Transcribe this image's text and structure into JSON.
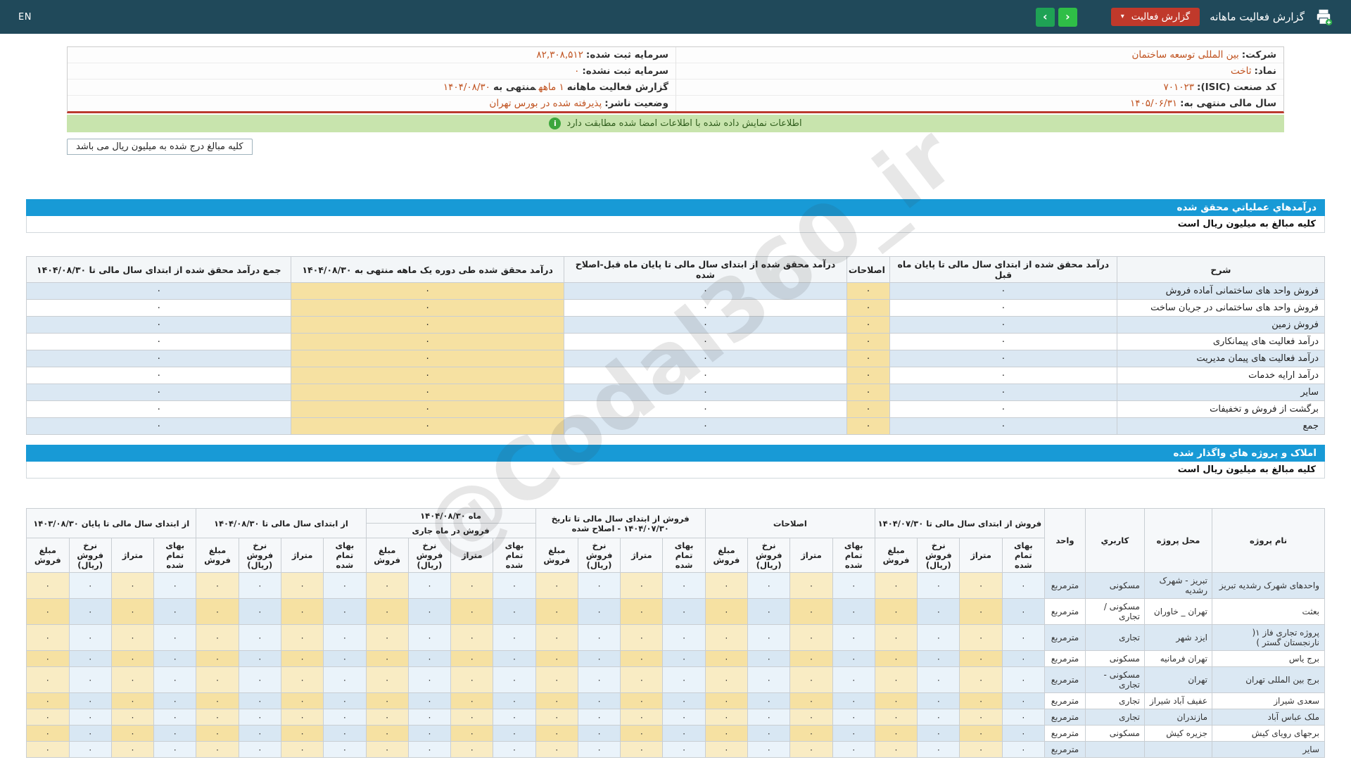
{
  "colors": {
    "navbar_bg": "#20495a",
    "accent_blue": "#189ad6",
    "button_red": "#c0392b",
    "notice_green_bg": "#c8e4ad",
    "highlight_tan": "#f6e1a2",
    "stripe_blue": "#dbe8f3",
    "value_orange": "#c0521f",
    "nav_green": "#2fbe47"
  },
  "navbar": {
    "en_label": "EN",
    "title": "گزارش فعالیت ماهانه",
    "report_button_label": "گزارش فعالیت",
    "caret_icon": "▾",
    "prev_icon": "‹",
    "next_icon": "›"
  },
  "company_info": {
    "right_rows": [
      {
        "label": "شرکت:",
        "value": "بین المللی توسعه ساختمان"
      },
      {
        "label": "نماد:",
        "value": "ثاخت"
      },
      {
        "label": "کد صنعت (ISIC):",
        "value": "۷۰۱۰۲۳"
      },
      {
        "label": "سال مالی منتهی به:",
        "value": "۱۴۰۵/۰۶/۳۱"
      }
    ],
    "left_rows": [
      {
        "label": "سرمایه ثبت شده:",
        "value": "۸۲,۳۰۸,۵۱۲",
        "label2": "",
        "value2": ""
      },
      {
        "label": "سرمایه ثبت نشده:",
        "value": "۰",
        "label2": "",
        "value2": ""
      },
      {
        "label": "گزارش فعالیت ماهانه",
        "value": "۱ ماهه",
        "label2": "منتهی به",
        "value2": "۱۴۰۴/۰۸/۳۰"
      },
      {
        "label": "وضعیت ناشر:",
        "value": "پذیرفته شده در بورس تهران",
        "label2": "",
        "value2": ""
      }
    ]
  },
  "notice": {
    "text": "اطلاعات نمایش داده شده با اطلاعات امضا شده مطابقت دارد",
    "icon": "i"
  },
  "amounts_tab": {
    "label": "کلیه مبالغ درج شده به میلیون ریال می باشد"
  },
  "section_revenue": {
    "title": "درآمدهاي عملياتي محقق شده",
    "subtitle": "کلیه مبالغ به میلیون ریال است",
    "table": {
      "headers": [
        "شرح",
        "درآمد محقق شده از ابتدای سال مالی تا پایان ماه قبل",
        "اصلاحات",
        "درآمد محقق شده از ابتدای سال مالی تا پایان ماه قبل-اصلاح شده",
        "درآمد محقق شده طی دوره یک ماهه منتهی به ۱۴۰۴/۰۸/۳۰",
        "جمع درآمد محقق شده از ابتدای سال مالی تا ۱۴۰۴/۰۸/۳۰"
      ],
      "rows": [
        {
          "label": "فروش واحد های ساختمانی آماده فروش",
          "values": [
            "۰",
            "۰",
            "۰",
            "۰",
            "۰"
          ]
        },
        {
          "label": "فروش واحد های ساختمانی در جریان ساخت",
          "values": [
            "۰",
            "۰",
            "۰",
            "۰",
            "۰"
          ]
        },
        {
          "label": "فروش زمین",
          "values": [
            "۰",
            "۰",
            "۰",
            "۰",
            "۰"
          ]
        },
        {
          "label": "درآمد فعالیت های پیمانکاری",
          "values": [
            "۰",
            "۰",
            "۰",
            "۰",
            "۰"
          ]
        },
        {
          "label": "درآمد فعالیت های پیمان مدیریت",
          "values": [
            "۰",
            "۰",
            "۰",
            "۰",
            "۰"
          ]
        },
        {
          "label": "درآمد ارایه خدمات",
          "values": [
            "۰",
            "۰",
            "۰",
            "۰",
            "۰"
          ]
        },
        {
          "label": "سایر",
          "values": [
            "۰",
            "۰",
            "۰",
            "۰",
            "۰"
          ]
        },
        {
          "label": "برگشت از فروش و تخفیفات",
          "values": [
            "۰",
            "۰",
            "۰",
            "۰",
            "۰"
          ]
        },
        {
          "label": "جمع",
          "values": [
            "۰",
            "۰",
            "۰",
            "۰",
            "۰"
          ]
        }
      ]
    }
  },
  "section_projects": {
    "title": "املاک و پروژه هاي واگذار شده",
    "subtitle": "کلیه مبالغ به میلیون ریال است",
    "table": {
      "fixed_headers": [
        "نام پروژه",
        "محل پروژه",
        "کاربري",
        "واحد"
      ],
      "col_groups": [
        {
          "label": "فروش از ابتدای سال مالی تا ۱۴۰۴/۰۷/۳۰"
        },
        {
          "label": "اصلاحات"
        },
        {
          "label": "فروش از ابتدای سال مالی تا تاریخ ۱۴۰۴/۰۷/۳۰ - اصلاح شده"
        },
        {
          "label": "ماه ۱۴۰۴/۰۸/۳۰",
          "sub": "فروش در ماه جاری"
        },
        {
          "label": "از ابتدای سال مالی تا ۱۴۰۴/۰۸/۳۰"
        },
        {
          "label": "از ابتدای سال مالی تا پایان ۱۴۰۳/۰۸/۳۰"
        }
      ],
      "sub_headers": [
        "بهای تمام شده",
        "متراژ",
        "نرخ فروش (ریال)",
        "مبلغ فروش"
      ],
      "rows": [
        {
          "name": "واحدهای شهرک رشدیه تبریز",
          "location": "تبریز - شهرک رشدیه",
          "usage": "مسکونی",
          "unit": "مترمربع",
          "values": [
            "۰",
            "۰",
            "۰",
            "۰",
            "۰",
            "۰",
            "۰",
            "۰",
            "۰",
            "۰",
            "۰",
            "۰",
            "۰",
            "۰",
            "۰",
            "۰",
            "۰",
            "۰",
            "۰",
            "۰",
            "۰",
            "۰",
            "۰",
            "۰"
          ]
        },
        {
          "name": "بعثت",
          "location": "تهران _ خاوران",
          "usage": "مسکونی / تجاری",
          "unit": "مترمربع",
          "values": [
            "۰",
            "۰",
            "۰",
            "۰",
            "۰",
            "۰",
            "۰",
            "۰",
            "۰",
            "۰",
            "۰",
            "۰",
            "۰",
            "۰",
            "۰",
            "۰",
            "۰",
            "۰",
            "۰",
            "۰",
            "۰",
            "۰",
            "۰",
            "۰"
          ]
        },
        {
          "name": "پروژه تجاری فاز ۱( نارنجستان گستر )",
          "location": "ایزد شهر",
          "usage": "تجاری",
          "unit": "مترمربع",
          "values": [
            "۰",
            "۰",
            "۰",
            "۰",
            "۰",
            "۰",
            "۰",
            "۰",
            "۰",
            "۰",
            "۰",
            "۰",
            "۰",
            "۰",
            "۰",
            "۰",
            "۰",
            "۰",
            "۰",
            "۰",
            "۰",
            "۰",
            "۰",
            "۰"
          ]
        },
        {
          "name": "برج یاس",
          "location": "تهران فرمانیه",
          "usage": "مسکونی",
          "unit": "مترمربع",
          "values": [
            "۰",
            "۰",
            "۰",
            "۰",
            "۰",
            "۰",
            "۰",
            "۰",
            "۰",
            "۰",
            "۰",
            "۰",
            "۰",
            "۰",
            "۰",
            "۰",
            "۰",
            "۰",
            "۰",
            "۰",
            "۰",
            "۰",
            "۰",
            "۰"
          ]
        },
        {
          "name": "برج بین المللی تهران",
          "location": "تهران",
          "usage": "مسکونی - تجاری",
          "unit": "مترمربع",
          "values": [
            "۰",
            "۰",
            "۰",
            "۰",
            "۰",
            "۰",
            "۰",
            "۰",
            "۰",
            "۰",
            "۰",
            "۰",
            "۰",
            "۰",
            "۰",
            "۰",
            "۰",
            "۰",
            "۰",
            "۰",
            "۰",
            "۰",
            "۰",
            "۰"
          ]
        },
        {
          "name": "سعدی شیراز",
          "location": "عفیف آباد شیراز",
          "usage": "تجاری",
          "unit": "مترمربع",
          "values": [
            "۰",
            "۰",
            "۰",
            "۰",
            "۰",
            "۰",
            "۰",
            "۰",
            "۰",
            "۰",
            "۰",
            "۰",
            "۰",
            "۰",
            "۰",
            "۰",
            "۰",
            "۰",
            "۰",
            "۰",
            "۰",
            "۰",
            "۰",
            "۰"
          ]
        },
        {
          "name": "ملک عباس آباد",
          "location": "مازندران",
          "usage": "تجاری",
          "unit": "مترمربع",
          "values": [
            "۰",
            "۰",
            "۰",
            "۰",
            "۰",
            "۰",
            "۰",
            "۰",
            "۰",
            "۰",
            "۰",
            "۰",
            "۰",
            "۰",
            "۰",
            "۰",
            "۰",
            "۰",
            "۰",
            "۰",
            "۰",
            "۰",
            "۰",
            "۰"
          ]
        },
        {
          "name": "برجهای رویای کیش",
          "location": "جزیره کیش",
          "usage": "مسکونی",
          "unit": "مترمربع",
          "values": [
            "۰",
            "۰",
            "۰",
            "۰",
            "۰",
            "۰",
            "۰",
            "۰",
            "۰",
            "۰",
            "۰",
            "۰",
            "۰",
            "۰",
            "۰",
            "۰",
            "۰",
            "۰",
            "۰",
            "۰",
            "۰",
            "۰",
            "۰",
            "۰"
          ]
        },
        {
          "name": "سایر",
          "location": "",
          "usage": "",
          "unit": "مترمربع",
          "values": [
            "۰",
            "۰",
            "۰",
            "۰",
            "۰",
            "۰",
            "۰",
            "۰",
            "۰",
            "۰",
            "۰",
            "۰",
            "۰",
            "۰",
            "۰",
            "۰",
            "۰",
            "۰",
            "۰",
            "۰",
            "۰",
            "۰",
            "۰",
            "۰"
          ]
        }
      ]
    }
  },
  "watermark": {
    "text": "@Codal360_ir"
  }
}
